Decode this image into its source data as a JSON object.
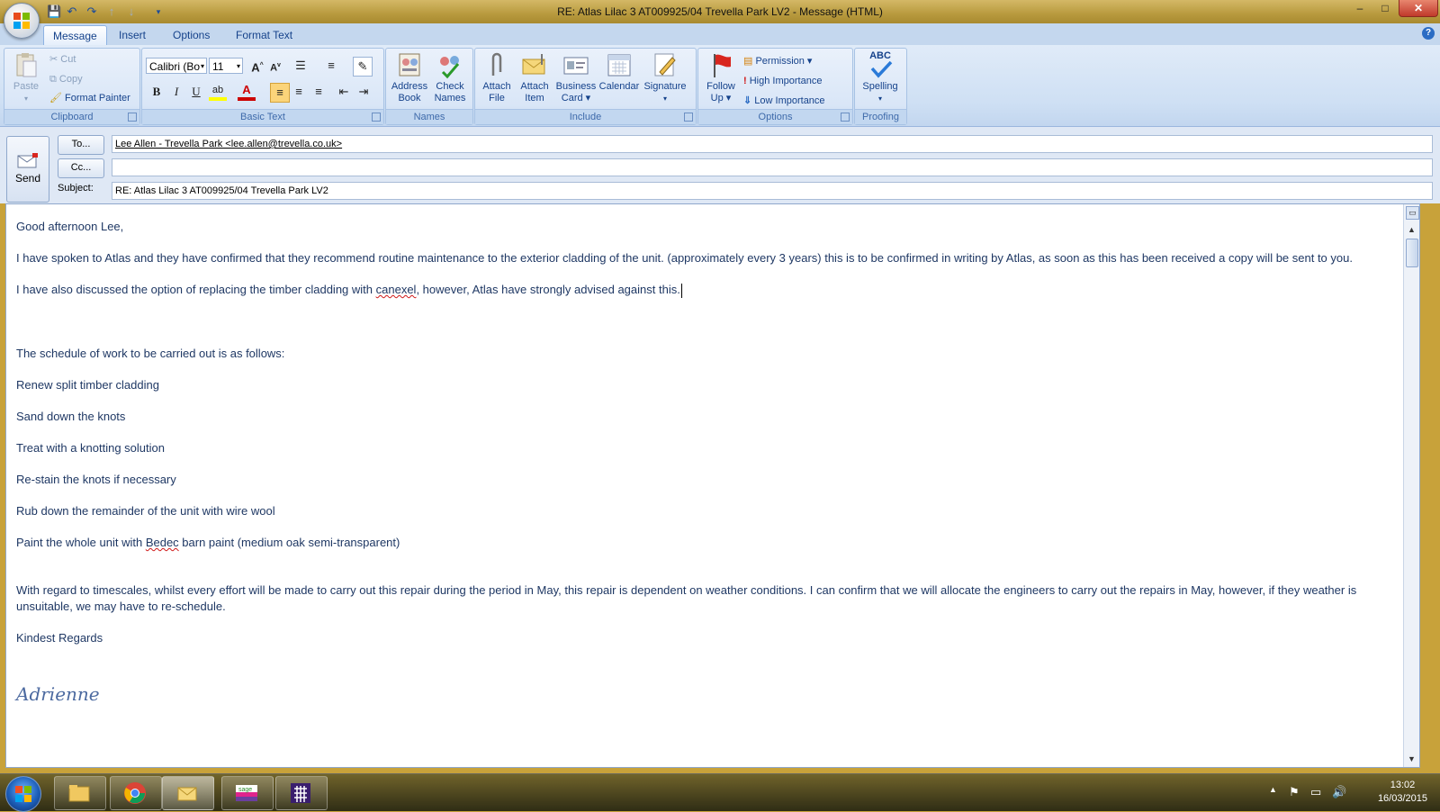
{
  "window": {
    "title": "RE: Atlas Lilac 3 AT009925/04 Trevella Park LV2 - Message (HTML)",
    "minimize": "–",
    "maximize": "□",
    "close": "✕"
  },
  "ribbon": {
    "tabs": [
      "Message",
      "Insert",
      "Options",
      "Format Text"
    ],
    "groups": {
      "clipboard": {
        "label": "Clipboard",
        "paste": "Paste",
        "cut": "Cut",
        "copy": "Copy",
        "format_painter": "Format Painter"
      },
      "basic_text": {
        "label": "Basic Text",
        "font": "Calibri (Bo",
        "size": "11"
      },
      "names": {
        "label": "Names",
        "address_book_1": "Address",
        "address_book_2": "Book",
        "check_names_1": "Check",
        "check_names_2": "Names"
      },
      "include": {
        "label": "Include",
        "attach_file_1": "Attach",
        "attach_file_2": "File",
        "attach_item_1": "Attach",
        "attach_item_2": "Item",
        "business_card_1": "Business",
        "business_card_2": "Card",
        "calendar": "Calendar",
        "signature": "Signature"
      },
      "options": {
        "label": "Options",
        "follow_up_1": "Follow",
        "follow_up_2": "Up",
        "permission": "Permission",
        "high_importance": "High Importance",
        "low_importance": "Low Importance"
      },
      "proofing": {
        "label": "Proofing",
        "spelling": "Spelling",
        "abc": "ABC"
      }
    }
  },
  "compose": {
    "send": "Send",
    "to_button": "To...",
    "cc_button": "Cc...",
    "subject_label": "Subject:",
    "to_value": "Lee Allen - Trevella Park <lee.allen@trevella.co.uk>",
    "cc_value": "",
    "subject_value": "RE: Atlas Lilac 3 AT009925/04 Trevella Park LV2"
  },
  "message": {
    "greeting": "Good afternoon Lee,",
    "para1": "I have spoken to Atlas and they have confirmed that they recommend routine maintenance to the exterior cladding of the unit. (approximately every 3 years)  this is to be confirmed in writing by Atlas, as soon as this has been received a copy will be  sent to you.",
    "para2_a": "I have also discussed the option of replacing the timber cladding  with ",
    "para2_b": "canexel",
    "para2_c": ", however, Atlas have strongly advised against this.",
    "schedule_intro": "The schedule of work to be carried out is as follows:",
    "steps": [
      "Renew split timber cladding",
      "Sand down the knots",
      "Treat with a knotting solution",
      "Re-stain the knots if necessary",
      "Rub down the remainder of the unit with wire wool"
    ],
    "step6_a": "Paint the whole unit with ",
    "step6_b": "Bedec",
    "step6_c": " barn paint (medium oak semi-transparent)",
    "para3": "With regard to timescales, whilst every effort will be made to carry out this repair during the period in May, this repair is dependent on weather conditions.  I can confirm that we will allocate the engineers to carry out the repairs in May, however, if they weather is unsuitable, we may have to re-schedule.",
    "closing": "Kindest Regards",
    "signature": "Adrienne"
  },
  "taskbar": {
    "time": "13:02",
    "date": "16/03/2015"
  }
}
